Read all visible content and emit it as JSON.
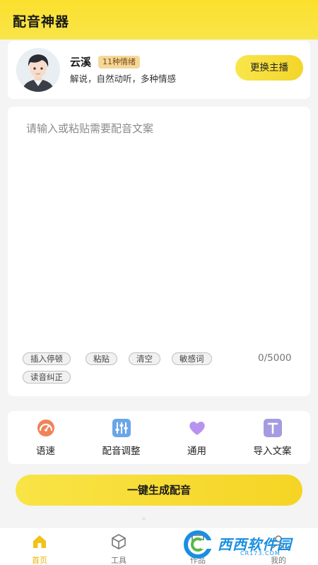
{
  "header": {
    "title": "配音神器"
  },
  "host": {
    "name": "云溪",
    "emotion_badge": "11种情绪",
    "description": "解说，自然动听，多种情感",
    "switch_label": "更换主播"
  },
  "editor": {
    "placeholder": "请输入或粘贴需要配音文案",
    "char_count": "0/5000",
    "tools": [
      "插入停顿",
      "粘贴",
      "清空",
      "敏感词",
      "读音纠正"
    ]
  },
  "functions": [
    {
      "label": "语速",
      "icon": "speed-gauge-icon"
    },
    {
      "label": "配音调整",
      "icon": "sliders-icon"
    },
    {
      "label": "通用",
      "icon": "heart-icon"
    },
    {
      "label": "导入文案",
      "icon": "text-t-icon"
    }
  ],
  "generate": {
    "label": "一键生成配音"
  },
  "tabbar": {
    "tabs": [
      {
        "label": "首页",
        "icon": "home-icon",
        "active": true
      },
      {
        "label": "工具",
        "icon": "cube-icon",
        "active": false
      },
      {
        "label": "作品",
        "icon": "works-icon",
        "active": false
      },
      {
        "label": "我的",
        "icon": "profile-icon",
        "active": false
      }
    ]
  },
  "watermark": {
    "text": "西西软件园",
    "sub": "CR173.COM"
  },
  "colors": {
    "brand_yellow": "#f9e446",
    "badge_bg": "#f4d79a",
    "active_tab": "#e8b400"
  }
}
